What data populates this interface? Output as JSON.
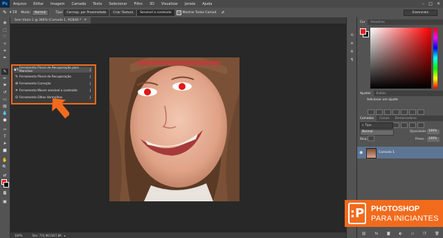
{
  "menubar": {
    "logo": "Ps",
    "items": [
      "Arquivo",
      "Editar",
      "Imagem",
      "Camada",
      "Texto",
      "Selecionar",
      "Filtro",
      "3D",
      "Visualizar",
      "Janela",
      "Ajuda"
    ],
    "window_controls": [
      "–",
      "□",
      "✕"
    ]
  },
  "options_bar": {
    "mode_label": "Modo:",
    "mode_value": "Normal",
    "type_label": "Tipo:",
    "btn_proximity": "Corresp. por Proximidade",
    "btn_texture": "Criar Textura",
    "btn_content_aware": "Sensível a conteúdo",
    "sample_all": "Mostrar Todas Camad.",
    "workspace": "Essenciais"
  },
  "document": {
    "tab_title": "Sem título-1 @ 366% (Camada 1, RGB/8) *",
    "status_zoom": "100%",
    "status_doc": "Doc: 753,9K/1007,8K"
  },
  "flyout": {
    "items": [
      {
        "label": "Ferramenta Pincel de Recuperação para Manchas",
        "key": "J",
        "icon": "spot-healing-brush-icon"
      },
      {
        "label": "Ferramenta Pincel de Recuperação",
        "key": "J",
        "icon": "healing-brush-icon"
      },
      {
        "label": "Ferramenta Correção",
        "key": "J",
        "icon": "patch-icon"
      },
      {
        "label": "Ferramenta Mover sensível a conteúdo",
        "key": "J",
        "icon": "content-aware-move-icon"
      },
      {
        "label": "Ferramenta Olhos Vermelhos",
        "key": "J",
        "icon": "red-eye-icon"
      }
    ]
  },
  "panels": {
    "color_tabs": [
      "Cor",
      "Amostras"
    ],
    "adjust_tabs": [
      "Ajustes",
      "Estilos"
    ],
    "adjust_title": "Adicionar um ajuste",
    "layers_tabs": [
      "Camadas",
      "Canais",
      "Demarcadores"
    ],
    "layer_filter": "Tipo",
    "blend_mode": "Normal",
    "opacity_label": "Opacidade:",
    "opacity_value": "100%",
    "lock_label": "Bloq.:",
    "fill_label": "Preen.:",
    "fill_value": "100%",
    "layer_name": "Camada 1",
    "foreground_color": "#e11d1d",
    "background_color": "#000000"
  },
  "badge": {
    "line1": "PHOTOSHOP",
    "line2": "PARA INICIANTES",
    "accent": "#f26b1d"
  }
}
